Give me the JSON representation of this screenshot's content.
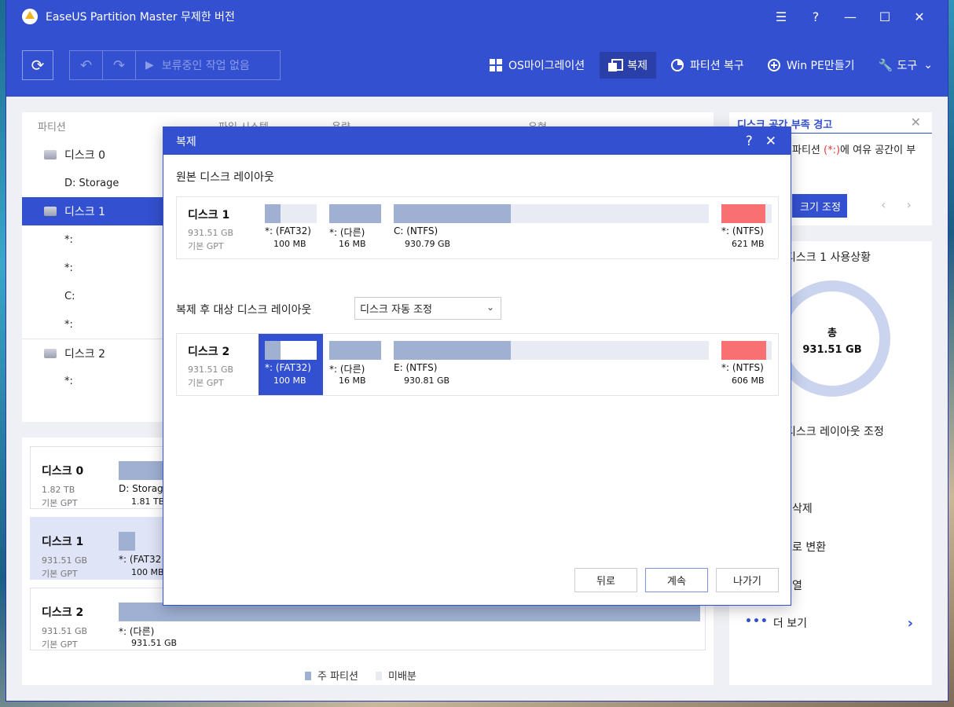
{
  "app": {
    "title": "EaseUS Partition Master 무제한 버전"
  },
  "window_controls": {
    "menu": "☰",
    "help": "?",
    "minimize": "—",
    "maximize": "☐",
    "close": "✕"
  },
  "toolbar": {
    "refresh": "⟳",
    "undo": "↶",
    "redo": "↷",
    "play": "▶",
    "pending_label": "보류중인 작업 없음",
    "menu": [
      {
        "label": "OS마이그레이션",
        "icon": "windows-icon"
      },
      {
        "label": "복제",
        "icon": "clone-icon",
        "active": true
      },
      {
        "label": "파티션 복구",
        "icon": "pie-icon"
      },
      {
        "label": "Win PE만들기",
        "icon": "plus-circle-icon"
      },
      {
        "label": "도구",
        "icon": "wrench-icon"
      }
    ]
  },
  "partition_table": {
    "headers": [
      "파티션",
      "파일 시스템",
      "용량",
      "유형"
    ],
    "rows": [
      {
        "label": "디스크 0",
        "kind": "disk"
      },
      {
        "label": "D: Storage",
        "kind": "part"
      },
      {
        "label": "디스크 1",
        "kind": "disk",
        "selected": true
      },
      {
        "label": "*:",
        "kind": "part"
      },
      {
        "label": "*:",
        "kind": "part"
      },
      {
        "label": "C:",
        "kind": "part"
      },
      {
        "label": "*:",
        "kind": "part"
      },
      {
        "label": "디스크 2",
        "kind": "disk"
      },
      {
        "label": "*:",
        "kind": "part"
      }
    ]
  },
  "disk_map": [
    {
      "name": "디스크 0",
      "size": "1.82 TB",
      "type": "기본 GPT",
      "part_label": "D: Storag",
      "part_size": "1.81 TB",
      "fill": 1.0
    },
    {
      "name": "디스크 1",
      "size": "931.51 GB",
      "type": "기본 GPT",
      "part_label": "*: (FAT32",
      "part_size": "100 MB",
      "fill": 0.35,
      "selected": true
    },
    {
      "name": "디스크 2",
      "size": "931.51 GB",
      "type": "기본 GPT",
      "part_label": "*: (다른)",
      "part_size": "931.51 GB",
      "fill": 1.0
    }
  ],
  "legend": {
    "primary": "주 파티션",
    "unallocated": "미배분"
  },
  "warning": {
    "title": "디스크 공간 부족 경고",
    "text_pre": "파티션 ",
    "text_red": "(*:)",
    "text_post": "에 여유 공간이 부",
    "button": "크기 조정"
  },
  "usage": {
    "title": "디스크 1 사용상황",
    "total_label": "총",
    "total_value": "931.51 GB",
    "links": [
      "디스크 레이아웃 조정",
      "삭제",
      "로 변환",
      "열"
    ],
    "more": "더 보기"
  },
  "dialog": {
    "title": "복제",
    "help": "?",
    "close": "✕",
    "source_heading": "원본 디스크 레이아웃",
    "target_heading": "복제 후 대상 디스크 레이아웃",
    "select_value": "디스크 자동 조정",
    "source": {
      "name": "디스크 1",
      "size": "931.51 GB",
      "type": "기본 GPT",
      "parts": [
        {
          "label": "*: (FAT32)",
          "size": "100 MB",
          "fill": 0.3
        },
        {
          "label": "*: (다른)",
          "size": "16 MB",
          "fill": 1.0
        },
        {
          "label": "C: (NTFS)",
          "size": "930.79 GB",
          "fill": 0.37
        },
        {
          "label": "*: (NTFS)",
          "size": "621 MB",
          "fill": 0.9,
          "color": "#f87172"
        }
      ]
    },
    "target": {
      "name": "디스크 2",
      "size": "931.51 GB",
      "type": "기본 GPT",
      "parts": [
        {
          "label": "*: (FAT32)",
          "size": "100 MB",
          "fill": 0.3,
          "selected": true
        },
        {
          "label": "*: (다른)",
          "size": "16 MB",
          "fill": 1.0
        },
        {
          "label": "E: (NTFS)",
          "size": "930.81 GB",
          "fill": 0.37
        },
        {
          "label": "*: (NTFS)",
          "size": "606 MB",
          "fill": 0.9,
          "color": "#f87172"
        }
      ]
    },
    "buttons": {
      "back": "뒤로",
      "next": "계속",
      "exit": "나가기"
    }
  }
}
